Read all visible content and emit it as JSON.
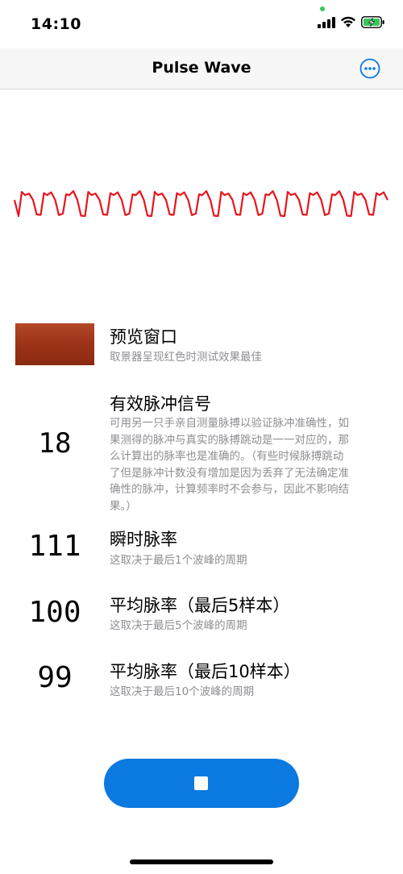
{
  "status_bar": {
    "time": "14:10",
    "icons": [
      "signal-icon",
      "wifi-icon",
      "battery-charging-icon"
    ],
    "accent_green": "#36c759"
  },
  "nav": {
    "title": "Pulse Wave",
    "more_icon": "more-circle-icon",
    "accent": "#0a79e0"
  },
  "waveform": {
    "color": "#e8141c",
    "icon": "pulse-waveform"
  },
  "preview": {
    "title": "预览窗口",
    "subtitle": "取景器呈现红色时测试效果最佳",
    "swatch_color": "#9c3317"
  },
  "valid_pulses": {
    "value": "18",
    "title": "有效脉冲信号",
    "description_lines": [
      "可用另一只手亲自测量脉搏以验证脉冲准确性，如",
      "果测得的脉冲与真实的脉搏跳动是一一对应的，那",
      "么计算出的脉率也是准确的。（有些时候脉搏跳动",
      "了但是脉冲计数没有增加是因为丢弃了无法确定准",
      "确性的脉冲，计算频率时不会参与，因此不影响结",
      "果。）"
    ]
  },
  "instant_rate": {
    "value": "111",
    "title": "瞬时脉率",
    "subtitle": "这取决于最后1个波峰的周期"
  },
  "avg5": {
    "value": "100",
    "title": "平均脉率（最后5样本）",
    "subtitle": "这取决于最后5个波峰的周期"
  },
  "avg10": {
    "value": "99",
    "title": "平均脉率（最后10样本）",
    "subtitle": "这取决于最后10个波峰的周期"
  },
  "stop_button": {
    "icon": "stop-icon",
    "color": "#0a79e0"
  }
}
